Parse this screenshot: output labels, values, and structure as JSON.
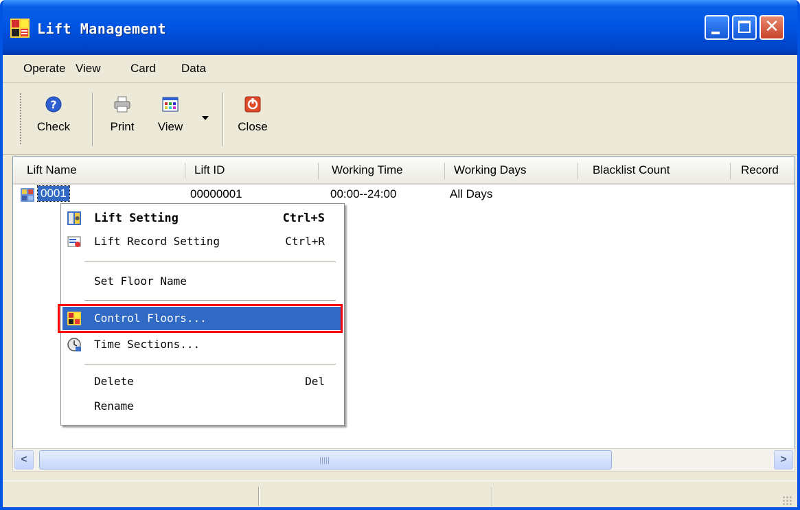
{
  "window": {
    "title": "Lift Management",
    "icon": "lift-app-icon"
  },
  "menubar": {
    "items": [
      "Operate",
      "View",
      "Card",
      "Data"
    ]
  },
  "toolbar": {
    "check_label": "Check",
    "print_label": "Print",
    "view_label": "View",
    "close_label": "Close"
  },
  "list": {
    "columns": [
      "Lift Name",
      "Lift ID",
      "Working Time",
      "Working Days",
      "Blacklist Count",
      "Record"
    ],
    "rows": [
      {
        "name": "0001",
        "id": "00000001",
        "working_time": "00:00--24:00",
        "working_days": "All Days",
        "blacklist_count": "",
        "record": ""
      }
    ]
  },
  "context_menu": {
    "lift_setting": "Lift Setting",
    "lift_setting_key": "Ctrl+S",
    "lift_record_setting": "Lift Record Setting",
    "lift_record_setting_key": "Ctrl+R",
    "set_floor_name": "Set Floor Name",
    "control_floors": "Control Floors...",
    "time_sections": "Time Sections...",
    "delete": "Delete",
    "delete_key": "Del",
    "rename": "Rename"
  },
  "colors": {
    "titlebar": "#0054e3",
    "selection": "#316ac5",
    "highlight_box": "#ff0000"
  }
}
